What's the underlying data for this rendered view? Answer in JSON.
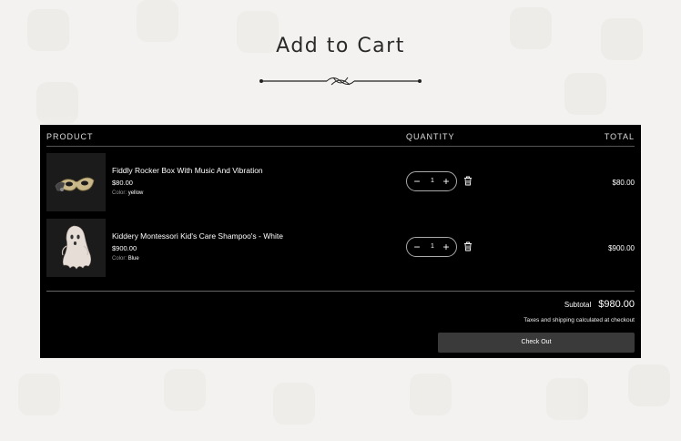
{
  "page": {
    "title": "Add to Cart"
  },
  "cart": {
    "headers": {
      "product": "PRODUCT",
      "quantity": "QUANTITY",
      "total": "TOTAL"
    },
    "items": [
      {
        "name": "Fiddly Rocker Box With Music And Vibration",
        "price": "$80.00",
        "option_label": "Color:",
        "option_value": "yellow",
        "quantity": "1",
        "line_total": "$80.00",
        "image_icon": "masquerade-mask-icon"
      },
      {
        "name": "Kiddery Montessori Kid's Care Shampoo's - White",
        "price": "$900.00",
        "option_label": "Color:",
        "option_value": "Blue",
        "quantity": "1",
        "line_total": "$900.00",
        "image_icon": "ghost-costume-icon"
      }
    ],
    "subtotal_label": "Subtotal",
    "subtotal_value": "$980.00",
    "tax_note": "Taxes and shipping calculated at checkout",
    "checkout_label": "Check Out"
  },
  "colors": {
    "background": "#f3f2f0",
    "panel": "#000000",
    "button": "#3a3a3a"
  }
}
